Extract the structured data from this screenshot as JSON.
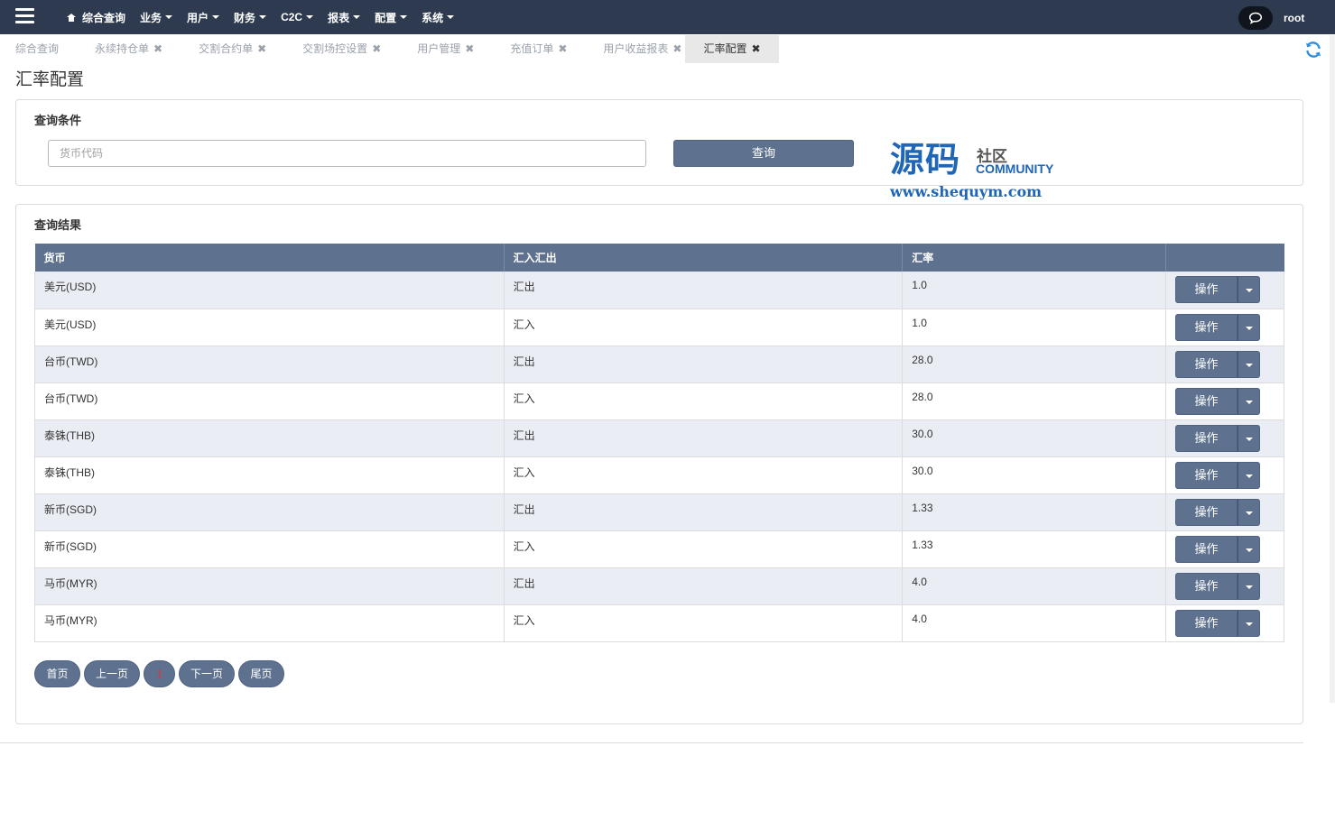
{
  "nav": {
    "items": [
      {
        "label": "综合查询",
        "icon": "home-icon",
        "has_caret": false
      },
      {
        "label": "业务",
        "has_caret": true
      },
      {
        "label": "用户",
        "has_caret": true
      },
      {
        "label": "财务",
        "has_caret": true
      },
      {
        "label": "C2C",
        "has_caret": true
      },
      {
        "label": "报表",
        "has_caret": true
      },
      {
        "label": "配置",
        "has_caret": true
      },
      {
        "label": "系统",
        "has_caret": true
      }
    ],
    "user": "root"
  },
  "tabs": [
    {
      "label": "综合查询",
      "closable": false,
      "active": false
    },
    {
      "label": "永续持仓单",
      "closable": true,
      "active": false
    },
    {
      "label": "交割合约单",
      "closable": true,
      "active": false
    },
    {
      "label": "交割场控设置",
      "closable": true,
      "active": false
    },
    {
      "label": "用户管理",
      "closable": true,
      "active": false
    },
    {
      "label": "充值订单",
      "closable": true,
      "active": false
    },
    {
      "label": "用户收益报表",
      "closable": true,
      "active": false
    },
    {
      "label": "汇率配置",
      "closable": true,
      "active": true
    }
  ],
  "close_glyph": "✖",
  "page_title": "汇率配置",
  "query": {
    "title": "查询条件",
    "placeholder": "货币代码",
    "value": "",
    "button": "查询"
  },
  "watermark": {
    "main": "源码",
    "sub1": "社区",
    "sub2": "COMMUNITY",
    "url": "www.shequym.com"
  },
  "results": {
    "title": "查询结果",
    "columns": [
      "货币",
      "汇入汇出",
      "汇率",
      ""
    ],
    "rows": [
      {
        "currency": "美元(USD)",
        "direction": "汇出",
        "rate": "1.0"
      },
      {
        "currency": "美元(USD)",
        "direction": "汇入",
        "rate": "1.0"
      },
      {
        "currency": "台币(TWD)",
        "direction": "汇出",
        "rate": "28.0"
      },
      {
        "currency": "台币(TWD)",
        "direction": "汇入",
        "rate": "28.0"
      },
      {
        "currency": "泰铢(THB)",
        "direction": "汇出",
        "rate": "30.0"
      },
      {
        "currency": "泰铢(THB)",
        "direction": "汇入",
        "rate": "30.0"
      },
      {
        "currency": "新币(SGD)",
        "direction": "汇出",
        "rate": "1.33"
      },
      {
        "currency": "新币(SGD)",
        "direction": "汇入",
        "rate": "1.33"
      },
      {
        "currency": "马币(MYR)",
        "direction": "汇出",
        "rate": "4.0"
      },
      {
        "currency": "马币(MYR)",
        "direction": "汇入",
        "rate": "4.0"
      }
    ],
    "action_label": "操作"
  },
  "pager": {
    "first": "首页",
    "prev": "上一页",
    "current": "1",
    "next": "下一页",
    "last": "尾页"
  },
  "colors": {
    "topbar": "#2d3a4f",
    "accent": "#5e718f",
    "row_alt": "#eaeef4",
    "watermark_blue": "#1f66b6"
  }
}
